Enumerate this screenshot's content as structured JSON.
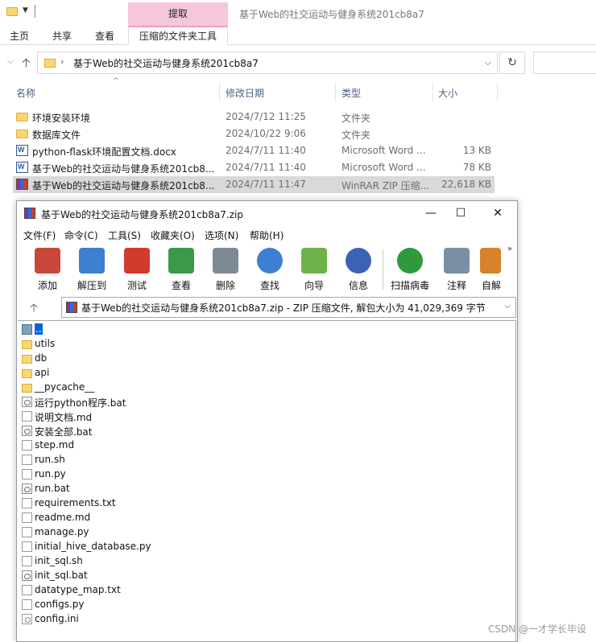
{
  "explorer": {
    "context_tab_header": "提取",
    "window_title": "基于Web的社交运动与健身系统201cb8a7",
    "ribbon_tabs": [
      "主页",
      "共享",
      "查看"
    ],
    "context_tab": "压缩的文件夹工具",
    "address": "基于Web的社交运动与健身系统201cb8a7",
    "columns": {
      "name": "名称",
      "date": "修改日期",
      "type": "类型",
      "size": "大小"
    },
    "files": [
      {
        "name": "环境安装环境",
        "date": "2024/7/12 11:25",
        "type": "文件夹",
        "size": "",
        "icon": "folder-icon"
      },
      {
        "name": "数据库文件",
        "date": "2024/10/22 9:06",
        "type": "文件夹",
        "size": "",
        "icon": "folder-icon"
      },
      {
        "name": "python-flask环境配置文档.docx",
        "date": "2024/7/11 11:40",
        "type": "Microsoft Word ...",
        "size": "13 KB",
        "icon": "word-doc-icon"
      },
      {
        "name": "基于Web的社交运动与健身系统201cb8...",
        "date": "2024/7/11 11:40",
        "type": "Microsoft Word ...",
        "size": "78 KB",
        "icon": "word-doc-icon"
      },
      {
        "name": "基于Web的社交运动与健身系统201cb8...",
        "date": "2024/7/11 11:47",
        "type": "WinRAR ZIP 压缩...",
        "size": "22,618 KB",
        "icon": "winrar-zip-icon"
      }
    ]
  },
  "winrar": {
    "title": "基于Web的社交运动与健身系统201cb8a7.zip",
    "menu": [
      "文件(F)",
      "命令(C)",
      "工具(S)",
      "收藏夹(O)",
      "选项(N)",
      "帮助(H)"
    ],
    "toolbar": [
      {
        "label": "添加",
        "icon": "add-books-icon",
        "color": "#c9473a"
      },
      {
        "label": "解压到",
        "icon": "extract-folder-icon",
        "color": "#3d7fd1"
      },
      {
        "label": "测试",
        "icon": "test-clipboard-icon",
        "color": "#d23a2e"
      },
      {
        "label": "查看",
        "icon": "view-book-icon",
        "color": "#3a9a4a"
      },
      {
        "label": "删除",
        "icon": "trash-icon",
        "color": "#7d8a96"
      },
      {
        "label": "查找",
        "icon": "magnifier-icon",
        "color": "#3d7fd1"
      },
      {
        "label": "向导",
        "icon": "wizard-wand-icon",
        "color": "#6fb24a"
      },
      {
        "label": "信息",
        "icon": "info-icon",
        "color": "#3b63b5"
      },
      {
        "label": "扫描病毒",
        "icon": "virus-scan-icon",
        "color": "#2e9a3c"
      },
      {
        "label": "注释",
        "icon": "comment-icon",
        "color": "#7a8fa6"
      },
      {
        "label": "自解",
        "icon": "sfx-box-icon",
        "color": "#d9822b"
      }
    ],
    "path": "基于Web的社交运动与健身系统201cb8a7.zip - ZIP 压缩文件, 解包大小为 41,029,369 字节",
    "items": [
      {
        "name": "..",
        "type": "up"
      },
      {
        "name": "utils",
        "type": "folder"
      },
      {
        "name": "db",
        "type": "folder"
      },
      {
        "name": "api",
        "type": "folder"
      },
      {
        "name": "__pycache__",
        "type": "folder"
      },
      {
        "name": "运行python程序.bat",
        "type": "bat"
      },
      {
        "name": "说明文档.md",
        "type": "doc"
      },
      {
        "name": "安装全部.bat",
        "type": "bat"
      },
      {
        "name": "step.md",
        "type": "doc"
      },
      {
        "name": "run.sh",
        "type": "doc"
      },
      {
        "name": "run.py",
        "type": "doc"
      },
      {
        "name": "run.bat",
        "type": "bat"
      },
      {
        "name": "requirements.txt",
        "type": "doc"
      },
      {
        "name": "readme.md",
        "type": "doc"
      },
      {
        "name": "manage.py",
        "type": "doc"
      },
      {
        "name": "initial_hive_database.py",
        "type": "doc"
      },
      {
        "name": "init_sql.sh",
        "type": "doc"
      },
      {
        "name": "init_sql.bat",
        "type": "bat"
      },
      {
        "name": "datatype_map.txt",
        "type": "doc"
      },
      {
        "name": "configs.py",
        "type": "doc"
      },
      {
        "name": "config.ini",
        "type": "ini"
      }
    ]
  },
  "watermark": "CSDN @一才学长毕设"
}
